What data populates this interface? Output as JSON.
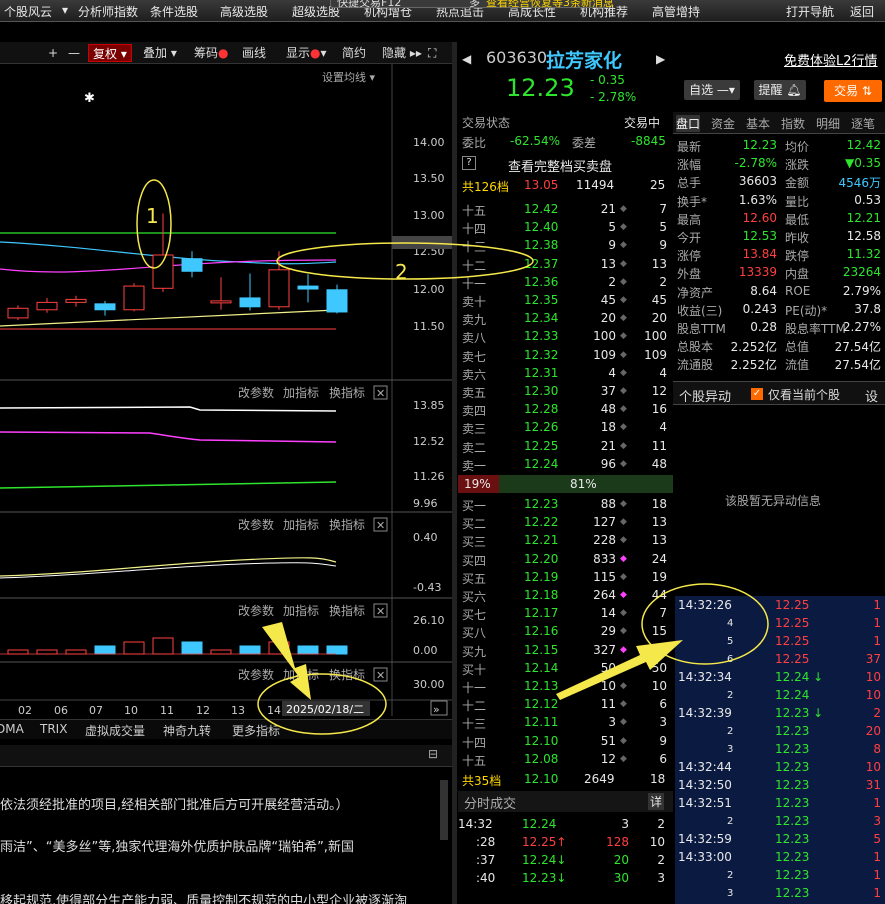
{
  "top_nav": {
    "items": [
      "个股风云",
      "分析师指数",
      "条件选股",
      "高级选股",
      "超级选股",
      "机构增仓",
      "热点追击",
      "高成长性",
      "机构推荐",
      "高管增持"
    ],
    "right": [
      "打开导航",
      "返回"
    ],
    "notice": "查看经营恢复等3条新消息",
    "quick_trade": "快捷交易F12",
    "cut": "多"
  },
  "toolbar": {
    "plus": "+",
    "minus": "—",
    "fuquan": "复权",
    "diejia": "叠加",
    "chouma": "筹码",
    "huaxian": "画线",
    "xianshi": "显示",
    "jianyue": "简约",
    "yincang": "隐藏"
  },
  "chart": {
    "setting": "设置均线",
    "y_main": [
      "14.00",
      "13.50",
      "13.00",
      "12.54",
      "12.50",
      "12.00",
      "11.50"
    ],
    "y_ind1": [
      "13.85",
      "12.52",
      "11.26",
      "9.96"
    ],
    "y_ind2": [
      "0.40",
      "-0.43"
    ],
    "y_ind3": [
      "26.10",
      "0.00"
    ],
    "y_ind4": [
      "30.00"
    ],
    "panel_actions": {
      "param": "改参数",
      "add": "加指标",
      "switch": "换指标",
      "close": "✕"
    },
    "annot1": "1",
    "annot2": "2",
    "x_labels": [
      "02",
      "06",
      "07",
      "10",
      "11",
      "12",
      "13",
      "14"
    ],
    "date_label": "2025/02/18/二",
    "template": "模板",
    "indicator_tabs": [
      "DMA",
      "TRIX",
      "虚拟成交量",
      "神奇九转",
      "更多指标"
    ],
    "candles": [
      {
        "o": 12.15,
        "c": 12.28,
        "h": 12.32,
        "l": 12.12
      },
      {
        "o": 12.26,
        "c": 12.36,
        "h": 12.42,
        "l": 12.22
      },
      {
        "o": 12.36,
        "c": 12.4,
        "h": 12.45,
        "l": 12.3
      },
      {
        "o": 12.34,
        "c": 12.26,
        "h": 12.38,
        "l": 12.18
      },
      {
        "o": 12.26,
        "c": 12.58,
        "h": 12.62,
        "l": 12.24
      },
      {
        "o": 12.55,
        "c": 13.0,
        "h": 13.56,
        "l": 12.5
      },
      {
        "o": 12.95,
        "c": 12.78,
        "h": 13.05,
        "l": 12.7
      },
      {
        "o": 12.36,
        "c": 12.38,
        "h": 12.7,
        "l": 12.26
      },
      {
        "o": 12.42,
        "c": 12.3,
        "h": 12.75,
        "l": 12.25
      },
      {
        "o": 12.3,
        "c": 12.8,
        "h": 13.05,
        "l": 12.26
      },
      {
        "o": 12.58,
        "c": 12.54,
        "h": 12.74,
        "l": 12.36
      },
      {
        "o": 12.53,
        "c": 12.23,
        "h": 12.6,
        "l": 12.21
      }
    ]
  },
  "info": {
    "line1": "依法须经批准的项目,经相关部门批准后方可开展经营活动。）",
    "line2": "雨洁”、“美多丝”等,独家代理海外优质护肤品牌“瑞铂希”,新国",
    "line3": "移起规范,使得部分生产能力弱、质量控制不规范的中小型企业被逐渐淘"
  },
  "quote": {
    "code": "603630",
    "name": "拉芳家化",
    "price": "12.23",
    "change": "- 0.35",
    "pct": "- 2.78%",
    "l2": "免费体验L2行情",
    "zixuan": "自选",
    "tixing": "提醒",
    "jiaoyi": "交易"
  },
  "order_book": {
    "status_label": "交易状态",
    "status_val": "交易中",
    "weibi_label": "委比",
    "weibi": "-62.54%",
    "weicha_label": "委差",
    "weicha": "-8845",
    "q_icon": "?",
    "full_book": "查看完整档买卖盘",
    "total_sell": {
      "label": "共126档",
      "price": "13.05",
      "vol": "11494",
      "cnt": "25"
    },
    "sells": [
      {
        "l": "十五",
        "p": "12.42",
        "v": "21",
        "c": "7"
      },
      {
        "l": "十四",
        "p": "12.40",
        "v": "5",
        "c": "5"
      },
      {
        "l": "十三",
        "p": "12.38",
        "v": "9",
        "c": "9"
      },
      {
        "l": "十二",
        "p": "12.37",
        "v": "13",
        "c": "13"
      },
      {
        "l": "十一",
        "p": "12.36",
        "v": "2",
        "c": "2"
      },
      {
        "l": "卖十",
        "p": "12.35",
        "v": "45",
        "c": "45"
      },
      {
        "l": "卖九",
        "p": "12.34",
        "v": "20",
        "c": "20"
      },
      {
        "l": "卖八",
        "p": "12.33",
        "v": "100",
        "c": "100"
      },
      {
        "l": "卖七",
        "p": "12.32",
        "v": "109",
        "c": "109"
      },
      {
        "l": "卖六",
        "p": "12.31",
        "v": "4",
        "c": "4"
      },
      {
        "l": "卖五",
        "p": "12.30",
        "v": "37",
        "c": "12"
      },
      {
        "l": "卖四",
        "p": "12.28",
        "v": "48",
        "c": "16"
      },
      {
        "l": "卖三",
        "p": "12.26",
        "v": "18",
        "c": "4"
      },
      {
        "l": "卖二",
        "p": "12.25",
        "v": "21",
        "c": "11"
      },
      {
        "l": "卖一",
        "p": "12.24",
        "v": "96",
        "c": "48"
      }
    ],
    "ratio_sell": "19%",
    "ratio_buy": "81%",
    "ratio_sell_frac": 0.19,
    "buys": [
      {
        "l": "买一",
        "p": "12.23",
        "v": "88",
        "c": "18"
      },
      {
        "l": "买二",
        "p": "12.22",
        "v": "127",
        "c": "13"
      },
      {
        "l": "买三",
        "p": "12.21",
        "v": "228",
        "c": "13"
      },
      {
        "l": "买四",
        "p": "12.20",
        "v": "833",
        "c": "24"
      },
      {
        "l": "买五",
        "p": "12.19",
        "v": "115",
        "c": "19"
      },
      {
        "l": "买六",
        "p": "12.18",
        "v": "264",
        "c": "44"
      },
      {
        "l": "买七",
        "p": "12.17",
        "v": "14",
        "c": "7"
      },
      {
        "l": "买八",
        "p": "12.16",
        "v": "29",
        "c": "15"
      },
      {
        "l": "买九",
        "p": "12.15",
        "v": "327",
        "c": "2"
      },
      {
        "l": "买十",
        "p": "12.14",
        "v": "50",
        "c": "50"
      },
      {
        "l": "十一",
        "p": "12.13",
        "v": "10",
        "c": "10"
      },
      {
        "l": "十二",
        "p": "12.12",
        "v": "11",
        "c": "6"
      },
      {
        "l": "十三",
        "p": "12.11",
        "v": "3",
        "c": "3"
      },
      {
        "l": "十四",
        "p": "12.10",
        "v": "51",
        "c": "9"
      },
      {
        "l": "十五",
        "p": "12.08",
        "v": "12",
        "c": "6"
      }
    ],
    "total_buy": {
      "label": "共35档",
      "price": "12.10",
      "vol": "2649",
      "cnt": "18"
    },
    "tick_title": "分时成交",
    "tick_detail": "详",
    "ticks": [
      {
        "t": "14:32",
        "p": "12.24",
        "a": "",
        "v": "3",
        "n": "2"
      },
      {
        "t": ":28",
        "p": "12.25",
        "a": "↑",
        "v": "128",
        "n": "10"
      },
      {
        "t": ":37",
        "p": "12.24",
        "a": "↓",
        "v": "20",
        "n": "2"
      },
      {
        "t": ":40",
        "p": "12.23",
        "a": "↓",
        "v": "30",
        "n": "3"
      }
    ]
  },
  "stats": {
    "tabs": [
      "盘口",
      "资金",
      "基本",
      "指数",
      "明细",
      "逐笔"
    ],
    "rows": [
      [
        "最新",
        "12.23",
        "均价",
        "12.42"
      ],
      [
        "涨幅",
        "-2.78%",
        "涨跌",
        "▼0.35"
      ],
      [
        "总手",
        "36603",
        "金额",
        "4546万"
      ],
      [
        "换手*",
        "1.63%",
        "量比",
        "0.53"
      ],
      [
        "最高",
        "12.60",
        "最低",
        "12.21"
      ],
      [
        "今开",
        "12.53",
        "昨收",
        "12.58"
      ],
      [
        "涨停",
        "13.84",
        "跌停",
        "11.32"
      ],
      [
        "外盘",
        "13339",
        "内盘",
        "23264"
      ],
      [
        "净资产",
        "8.64",
        "ROE",
        "2.79%"
      ],
      [
        "收益(三)",
        "0.243",
        "PE(动)*",
        "37.8"
      ],
      [
        "股息TTM",
        "0.28",
        "股息率TTM",
        "2.27%"
      ],
      [
        "总股本",
        "2.252亿",
        "总值",
        "27.54亿"
      ],
      [
        "流通股",
        "2.252亿",
        "流值",
        "27.54亿"
      ]
    ]
  },
  "abnormal": {
    "title": "个股异动",
    "checkbox": "仅看当前个股",
    "settings": "设",
    "empty": "该股暂无异动信息"
  },
  "trades": [
    {
      "t": "14:32:26",
      "p": "12.25",
      "a": "",
      "v": "1"
    },
    {
      "t": "4",
      "p": "12.25",
      "a": "",
      "v": "1"
    },
    {
      "t": "5",
      "p": "12.25",
      "a": "",
      "v": "1"
    },
    {
      "t": "6",
      "p": "12.25",
      "a": "",
      "v": "37"
    },
    {
      "t": "14:32:34",
      "p": "12.24",
      "a": "↓",
      "v": "10"
    },
    {
      "t": "2",
      "p": "12.24",
      "a": "",
      "v": "10"
    },
    {
      "t": "14:32:39",
      "p": "12.23",
      "a": "↓",
      "v": "2"
    },
    {
      "t": "2",
      "p": "12.23",
      "a": "",
      "v": "20"
    },
    {
      "t": "3",
      "p": "12.23",
      "a": "",
      "v": "8"
    },
    {
      "t": "14:32:44",
      "p": "12.23",
      "a": "",
      "v": "10"
    },
    {
      "t": "14:32:50",
      "p": "12.23",
      "a": "",
      "v": "31"
    },
    {
      "t": "14:32:51",
      "p": "12.23",
      "a": "",
      "v": "1"
    },
    {
      "t": "2",
      "p": "12.23",
      "a": "",
      "v": "3"
    },
    {
      "t": "14:32:59",
      "p": "12.23",
      "a": "",
      "v": "5"
    },
    {
      "t": "14:33:00",
      "p": "12.23",
      "a": "",
      "v": "1"
    },
    {
      "t": "2",
      "p": "12.23",
      "a": "",
      "v": "1"
    },
    {
      "t": "3",
      "p": "12.23",
      "a": "",
      "v": "1"
    }
  ],
  "colors": {
    "up": "#ff4040",
    "down": "#2ee52e",
    "accent": "#ffd700",
    "cyan": "#3ec8ff"
  }
}
